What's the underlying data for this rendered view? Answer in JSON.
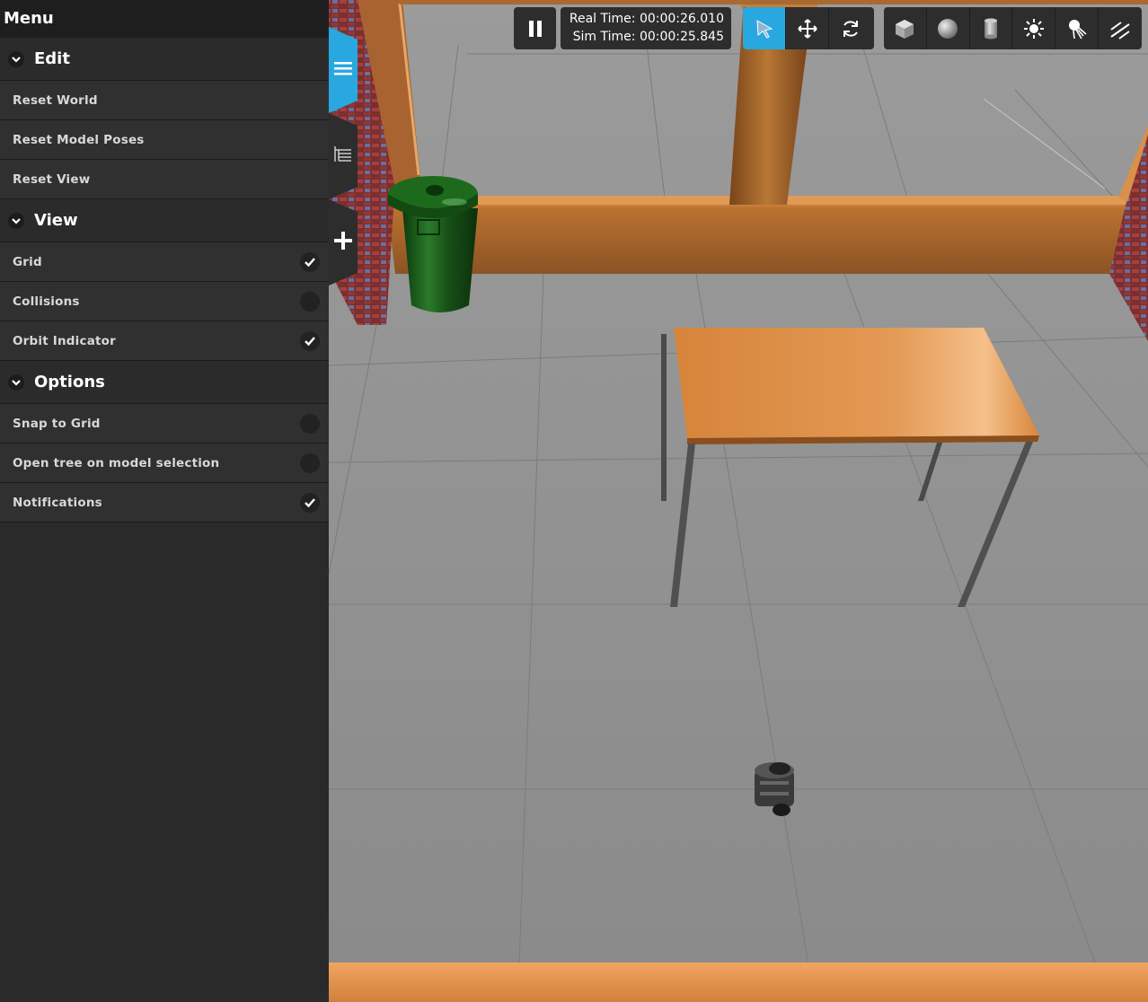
{
  "menu": {
    "title": "Menu",
    "sections": [
      {
        "label": "Edit",
        "items": [
          {
            "label": "Reset World"
          },
          {
            "label": "Reset Model Poses"
          },
          {
            "label": "Reset View"
          }
        ]
      },
      {
        "label": "View",
        "items": [
          {
            "label": "Grid",
            "checked": true
          },
          {
            "label": "Collisions",
            "checked": false
          },
          {
            "label": "Orbit Indicator",
            "checked": true
          }
        ]
      },
      {
        "label": "Options",
        "items": [
          {
            "label": "Snap to Grid",
            "checked": false
          },
          {
            "label": "Open tree on model selection",
            "checked": false
          },
          {
            "label": "Notifications",
            "checked": true
          }
        ]
      }
    ]
  },
  "side_tabs": [
    {
      "icon": "hamburger-icon",
      "active": true
    },
    {
      "icon": "tree-icon",
      "active": false
    },
    {
      "icon": "plus-icon",
      "active": false
    }
  ],
  "toolbar": {
    "play_state": "pause-icon",
    "real_time": "Real Time: 00:00:26.010",
    "sim_time": "Sim Time: 00:00:25.845",
    "manipulation_modes": [
      "select-arrow-icon",
      "translate-icon",
      "rotate-icon"
    ],
    "active_mode": "select-arrow-icon",
    "insert_shapes": [
      "box-icon",
      "sphere-icon",
      "cylinder-icon",
      "point-light-icon",
      "spot-light-icon",
      "directional-light-icon"
    ]
  },
  "colors": {
    "accent": "#29a8e0",
    "panel": "#2a2a2a",
    "floor": "#8f8f8f",
    "wood": "#b06a2c",
    "bin": "#1b5e1b"
  }
}
